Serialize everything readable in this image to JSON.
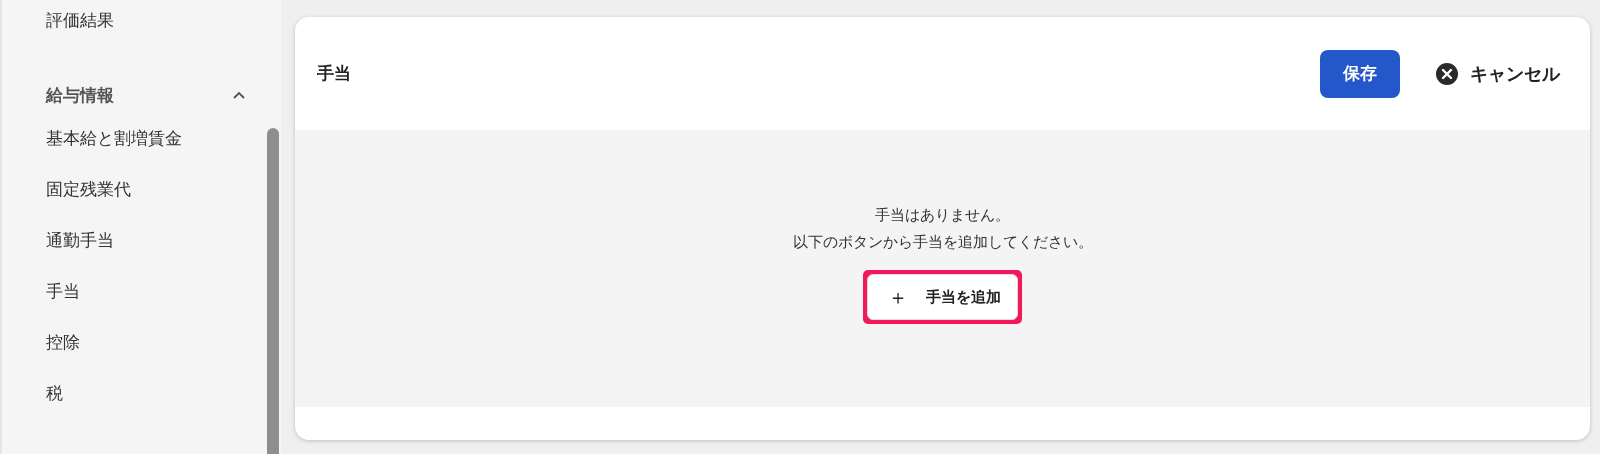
{
  "sidebar": {
    "items": [
      {
        "kind": "item",
        "label": "評価結果"
      },
      {
        "kind": "section",
        "label": "給与情報",
        "expanded": true,
        "children": [
          {
            "kind": "item",
            "label": "基本給と割増賃金"
          },
          {
            "kind": "item",
            "label": "固定残業代"
          },
          {
            "kind": "item",
            "label": "通勤手当"
          },
          {
            "kind": "item",
            "label": "手当"
          },
          {
            "kind": "item",
            "label": "控除"
          },
          {
            "kind": "item",
            "label": "税"
          }
        ]
      }
    ]
  },
  "card": {
    "title": "手当",
    "save_button": "保存",
    "cancel_button": "キャンセル",
    "empty_message": [
      "手当はありません。",
      "以下のボタンから手当を追加してください。"
    ],
    "add_button": {
      "icon": "＋",
      "label": "手当を追加",
      "highlighted": true
    }
  }
}
